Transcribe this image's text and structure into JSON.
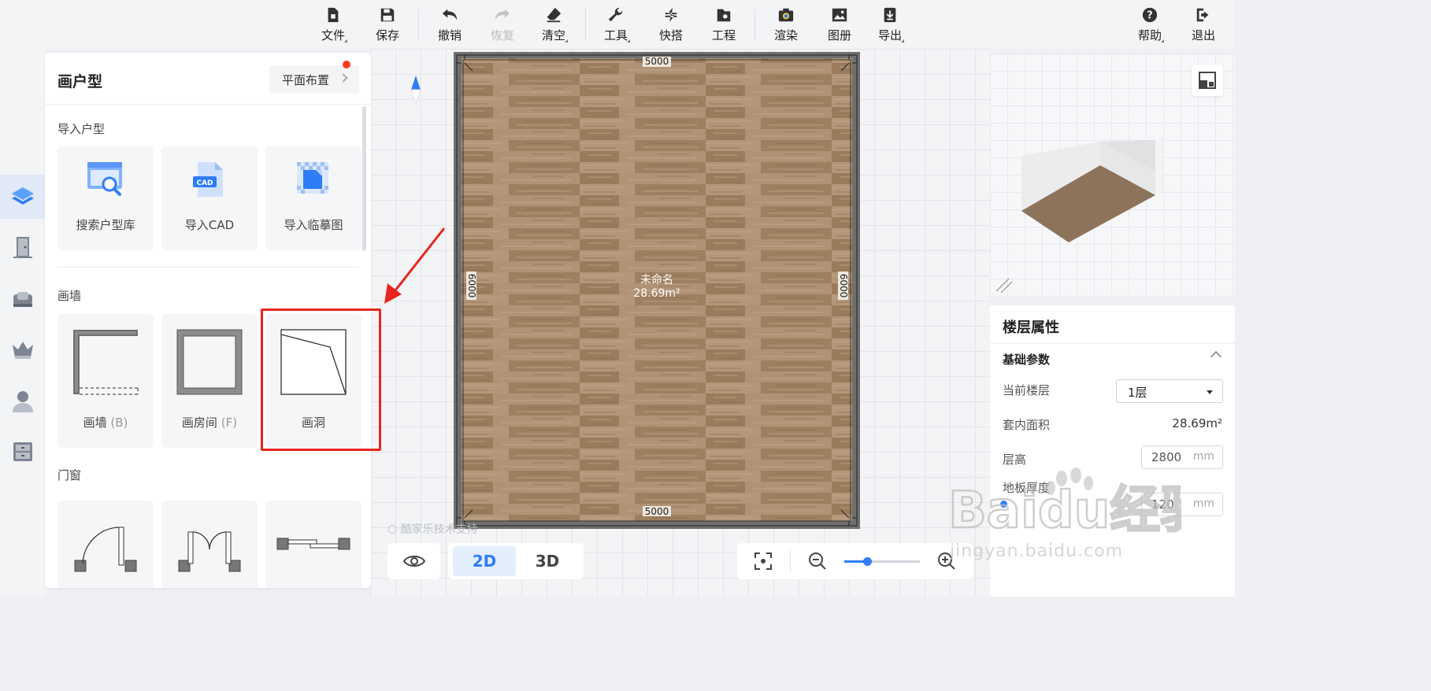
{
  "toolbar": {
    "file": "文件",
    "save": "保存",
    "undo": "撤销",
    "redo": "恢复",
    "clear": "清空",
    "tools": "工具",
    "quick": "快搭",
    "project": "工程",
    "render": "渲染",
    "album": "图册",
    "export": "导出",
    "help": "帮助",
    "exit": "退出"
  },
  "panel": {
    "title": "画户型",
    "layout_button": "平面布置",
    "import_section": "导入户型",
    "import_cards": [
      "搜索户型库",
      "导入CAD",
      "导入临摹图"
    ],
    "cad_badge": "CAD",
    "wall_section": "画墙",
    "wall_cards": [
      {
        "label": "画墙",
        "hotkey": "(B)"
      },
      {
        "label": "画房间",
        "hotkey": "(F)"
      },
      {
        "label": "画洞",
        "hotkey": ""
      }
    ],
    "door_section": "门窗"
  },
  "plan": {
    "room_name": "未命名",
    "room_area": "28.69m²",
    "dim_top": "5000",
    "dim_bottom": "5000",
    "dim_left": "6000",
    "dim_right": "6000",
    "floor_color": "#a88a6a"
  },
  "bottom": {
    "view_2d": "2D",
    "view_3d": "3D",
    "credit": "酷家乐技术支持",
    "zoom_fraction": 0.3
  },
  "props": {
    "title": "楼层属性",
    "section": "基础参数",
    "current_floor_label": "当前楼层",
    "current_floor_value": "1层",
    "area_label": "套内面积",
    "area_value": "28.69m²",
    "height_label": "层高",
    "height_value": "2800",
    "thickness_label": "地板厚度",
    "thickness_value": "120",
    "unit": "mm"
  },
  "watermark": {
    "brand": "Baidu经验",
    "url": "jingyan.baidu.com"
  },
  "colors": {
    "accent": "#2f7df6",
    "highlight": "#e8251d",
    "wall": "#6f6f6f"
  }
}
